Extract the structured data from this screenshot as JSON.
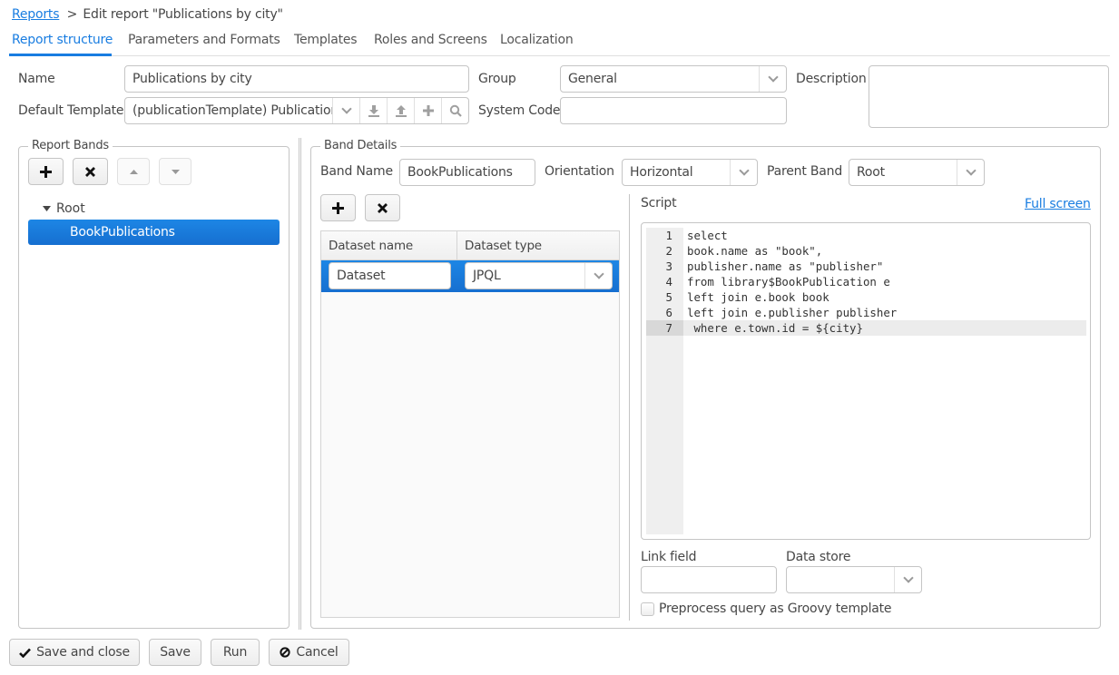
{
  "breadcrumb": {
    "root_link": "Reports",
    "separator": ">",
    "current": "Edit report \"Publications by city\""
  },
  "tabs": [
    {
      "label": "Report structure",
      "active": true
    },
    {
      "label": "Parameters and Formats",
      "active": false
    },
    {
      "label": "Templates",
      "active": false
    },
    {
      "label": "Roles and Screens",
      "active": false
    },
    {
      "label": "Localization",
      "active": false
    }
  ],
  "form": {
    "name_label": "Name",
    "name_value": "Publications by city",
    "group_label": "Group",
    "group_value": "General",
    "description_label": "Description",
    "description_value": "",
    "default_template_label": "Default Template",
    "default_template_value": "(publicationTemplate) Publication",
    "system_code_label": "System Code",
    "system_code_value": ""
  },
  "report_bands": {
    "legend": "Report Bands",
    "tree": [
      {
        "label": "Root",
        "expanded": true,
        "level": 0,
        "selected": false
      },
      {
        "label": "BookPublications",
        "level": 1,
        "selected": true
      }
    ]
  },
  "band_details": {
    "legend": "Band Details",
    "band_name_label": "Band Name",
    "band_name_value": "BookPublications",
    "orientation_label": "Orientation",
    "orientation_value": "Horizontal",
    "parent_band_label": "Parent Band",
    "parent_band_value": "Root",
    "datasets": {
      "columns": [
        "Dataset name",
        "Dataset type"
      ],
      "rows": [
        {
          "name": "Dataset",
          "type": "JPQL",
          "selected": true
        }
      ]
    },
    "script": {
      "label": "Script",
      "full_screen_link": "Full screen",
      "lines": [
        "select",
        "book.name as \"book\",",
        "publisher.name as \"publisher\"",
        "from library$BookPublication e",
        "left join e.book book",
        "left join e.publisher publisher",
        " where e.town.id = ${city}"
      ],
      "line_numbers": [
        "1",
        "2",
        "3",
        "4",
        "5",
        "6",
        "7"
      ],
      "active_line": 7
    },
    "link_field_label": "Link field",
    "link_field_value": "",
    "data_store_label": "Data store",
    "data_store_value": "",
    "groovy_checkbox_label": "Preprocess query as Groovy template",
    "groovy_checkbox_checked": false
  },
  "footer": {
    "save_and_close": "Save and close",
    "save": "Save",
    "run": "Run",
    "cancel": "Cancel"
  },
  "colors": {
    "accent": "#197de1",
    "selected_row": "#1b7de0",
    "border": "#c5c5c5"
  }
}
